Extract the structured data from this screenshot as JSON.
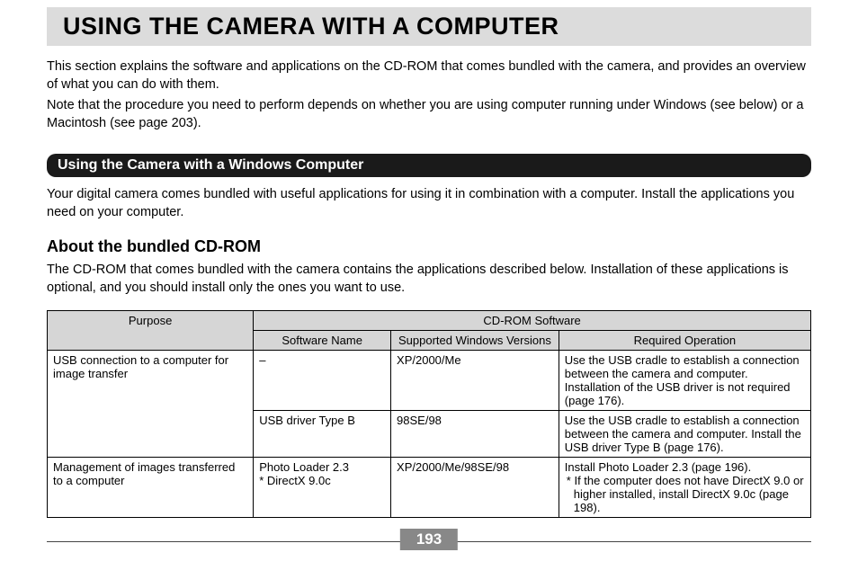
{
  "title": "USING THE CAMERA WITH A COMPUTER",
  "intro": {
    "p1": "This section explains the software and applications on the CD-ROM that comes bundled with the camera, and provides an overview of what you can do with them.",
    "p2": "Note that the procedure you need to perform depends on whether you are using computer running under Windows (see below) or a Macintosh (see page 203)."
  },
  "section1": {
    "heading": "Using the Camera with a Windows Computer",
    "body": "Your digital camera comes bundled with useful applications for using it in combination with a computer. Install the applications you need on your computer."
  },
  "section2": {
    "heading": "About the bundled CD-ROM",
    "body": "The CD-ROM that comes bundled with the camera contains the applications described below. Installation of these applications is optional, and you should install only the ones you want to use."
  },
  "chart_data": {
    "type": "table",
    "headers": {
      "purpose": "Purpose",
      "group": "CD-ROM Software",
      "software_name": "Software Name",
      "versions": "Supported Windows Versions",
      "operation": "Required Operation"
    },
    "rows": [
      {
        "purpose": "USB connection to a computer for image transfer",
        "software": "–",
        "versions": "XP/2000/Me",
        "operation": "Use the USB cradle to establish a connection between the camera and computer. Installation of the USB driver is not required (page 176)."
      },
      {
        "purpose": "",
        "software": "USB driver Type B",
        "versions": "98SE/98",
        "operation": "Use the USB cradle to establish a connection between the camera and computer. Install the USB driver Type B (page 176)."
      },
      {
        "purpose": "Management of images transferred to a computer",
        "software_line1": "Photo Loader 2.3",
        "software_line2": "* DirectX 9.0c",
        "versions": "XP/2000/Me/98SE/98",
        "operation_line1": "Install Photo Loader 2.3 (page 196).",
        "operation_line2": "* If the computer does not have DirectX 9.0 or higher installed, install DirectX 9.0c (page 198)."
      }
    ]
  },
  "page_number": "193"
}
